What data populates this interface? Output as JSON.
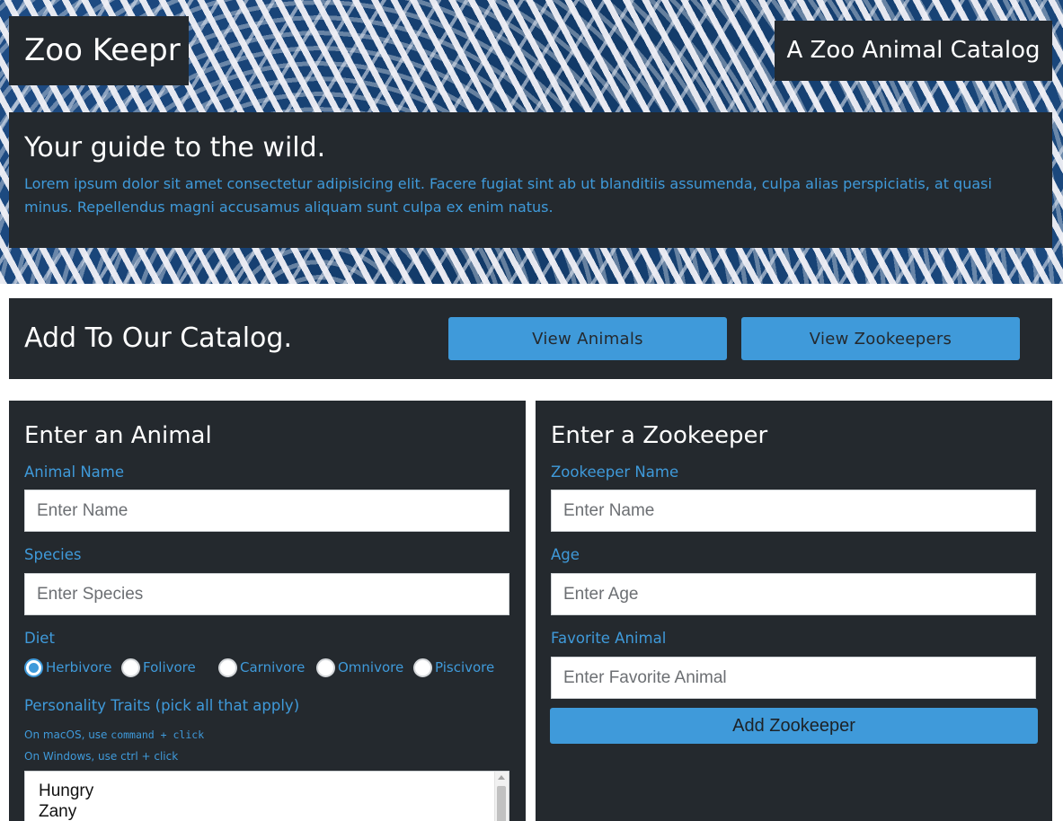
{
  "header": {
    "brand": "Zoo Keepr",
    "tagline": "A Zoo Animal Catalog"
  },
  "intro": {
    "heading": "Your guide to the wild.",
    "text": "Lorem ipsum dolor sit amet consectetur adipisicing elit. Facere fugiat sint ab ut blanditiis assumenda, culpa alias perspiciatis, at quasi minus. Repellendus magni accusamus aliquam sunt culpa ex enim natus."
  },
  "catalog": {
    "heading": "Add To Our Catalog.",
    "view_animals_label": "View Animals",
    "view_zookeepers_label": "View Zookeepers"
  },
  "animal_form": {
    "heading": "Enter an Animal",
    "name_label": "Animal Name",
    "name_placeholder": "Enter Name",
    "species_label": "Species",
    "species_placeholder": "Enter Species",
    "diet_label": "Diet",
    "diet_options": [
      {
        "label": "Herbivore",
        "checked": true
      },
      {
        "label": "Folivore",
        "checked": false
      },
      {
        "label": "Carnivore",
        "checked": false
      },
      {
        "label": "Omnivore",
        "checked": false
      },
      {
        "label": "Piscivore",
        "checked": false
      }
    ],
    "traits_label": "Personality Traits (pick all that apply)",
    "hint_mac_prefix": "On macOS, use",
    "hint_mac_keys": "command + click",
    "hint_windows": "On Windows, use ctrl + click",
    "traits_options": [
      "Hungry",
      "Zany"
    ]
  },
  "zookeeper_form": {
    "heading": "Enter a Zookeeper",
    "name_label": "Zookeeper Name",
    "name_placeholder": "Enter Name",
    "age_label": "Age",
    "age_placeholder": "Enter Age",
    "favorite_label": "Favorite Animal",
    "favorite_placeholder": "Enter Favorite Animal",
    "submit_label": "Add Zookeeper"
  },
  "colors": {
    "panel": "#24292e",
    "accent": "#3f9ada",
    "text": "#ffffff"
  }
}
